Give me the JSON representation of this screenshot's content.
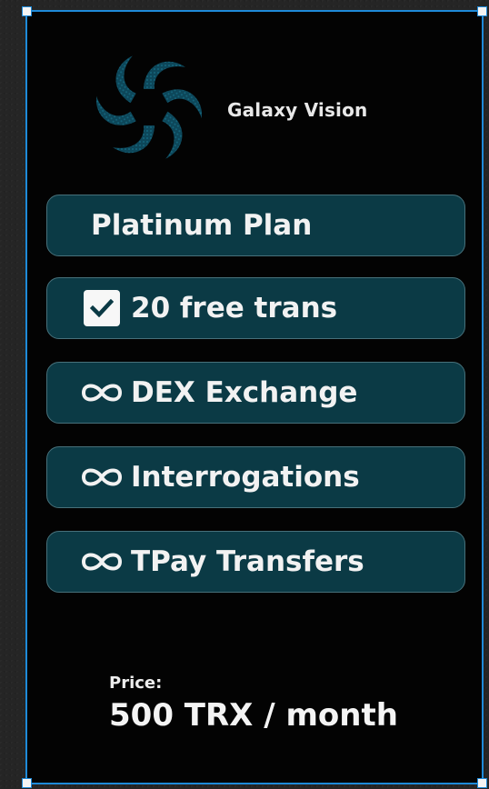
{
  "brand": {
    "name": "Galaxy Vision",
    "logo_icon": "spiral-galaxy-icon"
  },
  "plan": {
    "title": "Platinum Plan",
    "features": [
      {
        "icon": "checkbox-checked-icon",
        "label": "20 free trans"
      },
      {
        "icon": "infinity-icon",
        "label": "DEX Exchange"
      },
      {
        "icon": "infinity-icon",
        "label": "Interrogations"
      },
      {
        "icon": "infinity-icon",
        "label": "TPay Transfers"
      }
    ]
  },
  "price": {
    "label": "Price:",
    "value": "500 TRX / month"
  },
  "colors": {
    "card_background": "#030303",
    "pill_background": "#0b3a45",
    "pill_border": "#47707a",
    "selection_border": "#1e8ad9",
    "logo": "#0f4f63",
    "text": "#f2f2f2"
  }
}
